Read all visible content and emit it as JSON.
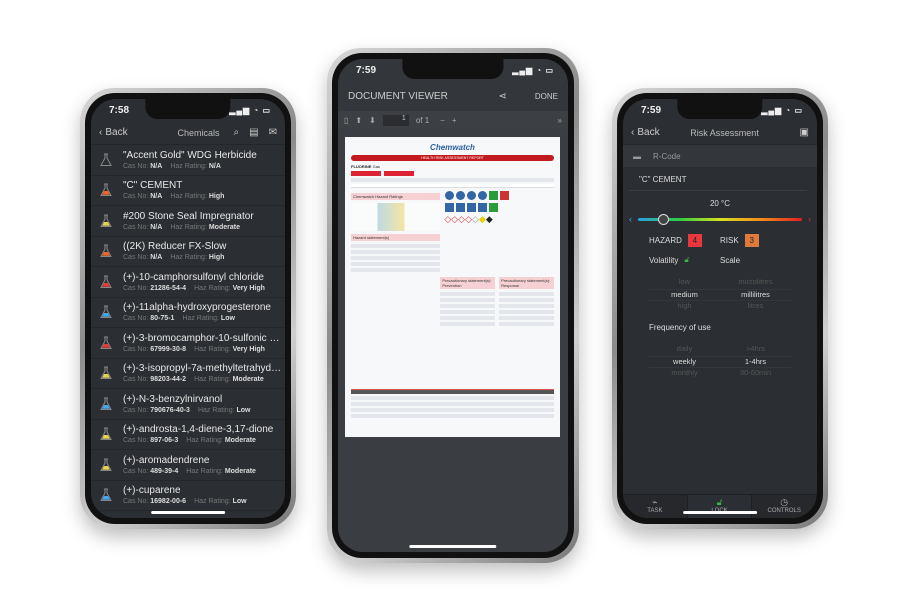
{
  "left": {
    "time": "7:58",
    "back": "Back",
    "title": "Chemicals",
    "icons": [
      "search-icon",
      "document-icon",
      "mail-icon"
    ],
    "cas_label": "Cas No:",
    "haz_label": "Haz Rating:",
    "items": [
      {
        "name": "\"Accent Gold\" WDG Herbicide",
        "cas": "N/A",
        "haz": "N/A",
        "color": "#2b2e33"
      },
      {
        "name": "\"C\" CEMENT",
        "cas": "N/A",
        "haz": "High",
        "color": "#f26522"
      },
      {
        "name": "#200 Stone Seal Impregnator",
        "cas": "N/A",
        "haz": "Moderate",
        "color": "#e8d44d"
      },
      {
        "name": "((2K) Reducer FX-Slow",
        "cas": "N/A",
        "haz": "High",
        "color": "#f26522"
      },
      {
        "name": "(+)-10-camphorsulfonyl chloride",
        "cas": "21286-54-4",
        "haz": "Very High",
        "color": "#e53935"
      },
      {
        "name": "(+)-11alpha-hydroxyprogesterone",
        "cas": "80-75-1",
        "haz": "Low",
        "color": "#3fa9f5"
      },
      {
        "name": "(+)-3-bromocamphor-10-sulfonic acid",
        "cas": "67999-30-8",
        "haz": "Very High",
        "color": "#e53935"
      },
      {
        "name": "(+)-3-isopropyl-7a-methyltetrahydropy...",
        "cas": "98203-44-2",
        "haz": "Moderate",
        "color": "#e8d44d"
      },
      {
        "name": "(+)-N-3-benzylnirvanol",
        "cas": "790676-40-3",
        "haz": "Low",
        "color": "#3fa9f5"
      },
      {
        "name": "(+)-androsta-1,4-diene-3,17-dione",
        "cas": "897-06-3",
        "haz": "Moderate",
        "color": "#e8d44d"
      },
      {
        "name": "(+)-aromadendrene",
        "cas": "489-39-4",
        "haz": "Moderate",
        "color": "#e8d44d"
      },
      {
        "name": "(+)-cuparene",
        "cas": "16982-00-6",
        "haz": "Low",
        "color": "#3fa9f5"
      }
    ]
  },
  "middle": {
    "time": "7:59",
    "title": "DOCUMENT VIEWER",
    "done": "DONE",
    "page": "1",
    "of": "of 1",
    "doc": {
      "logo": "Chemwatch",
      "report_title": "HEALTH RISK ASSESSMENT REPORT",
      "chemical": "FLUORINE",
      "state": "Gas",
      "sections": [
        "Chemwatch Hazard Ratings",
        "Hazard statement(s)",
        "Precautionary statement(s): Prevention",
        "Precautionary statement(s): Response"
      ]
    }
  },
  "right": {
    "time": "7:59",
    "back": "Back",
    "title": "Risk Assessment",
    "rcode": "R-Code",
    "chemical": "\"C\" CEMENT",
    "temperature": "20 °C",
    "temperature_value": 20,
    "hazard_label": "HAZARD",
    "hazard": "4",
    "hazard_color": "#e8383d",
    "risk_label": "RISK",
    "risk": "3",
    "risk_color": "#e07a3c",
    "volatility_label": "Volatility",
    "scale_label": "Scale",
    "volatility": [
      "low",
      "medium",
      "high"
    ],
    "scale": [
      "microlitres",
      "millilitres",
      "litres"
    ],
    "frequency_label": "Frequency of use",
    "frequency": [
      "daily",
      "weekly",
      "monthly"
    ],
    "duration": [
      ">4hrs",
      "1-4hrs",
      "30-60min"
    ],
    "tabs": [
      "TASK",
      "LOCK",
      "CONTROLS"
    ]
  }
}
